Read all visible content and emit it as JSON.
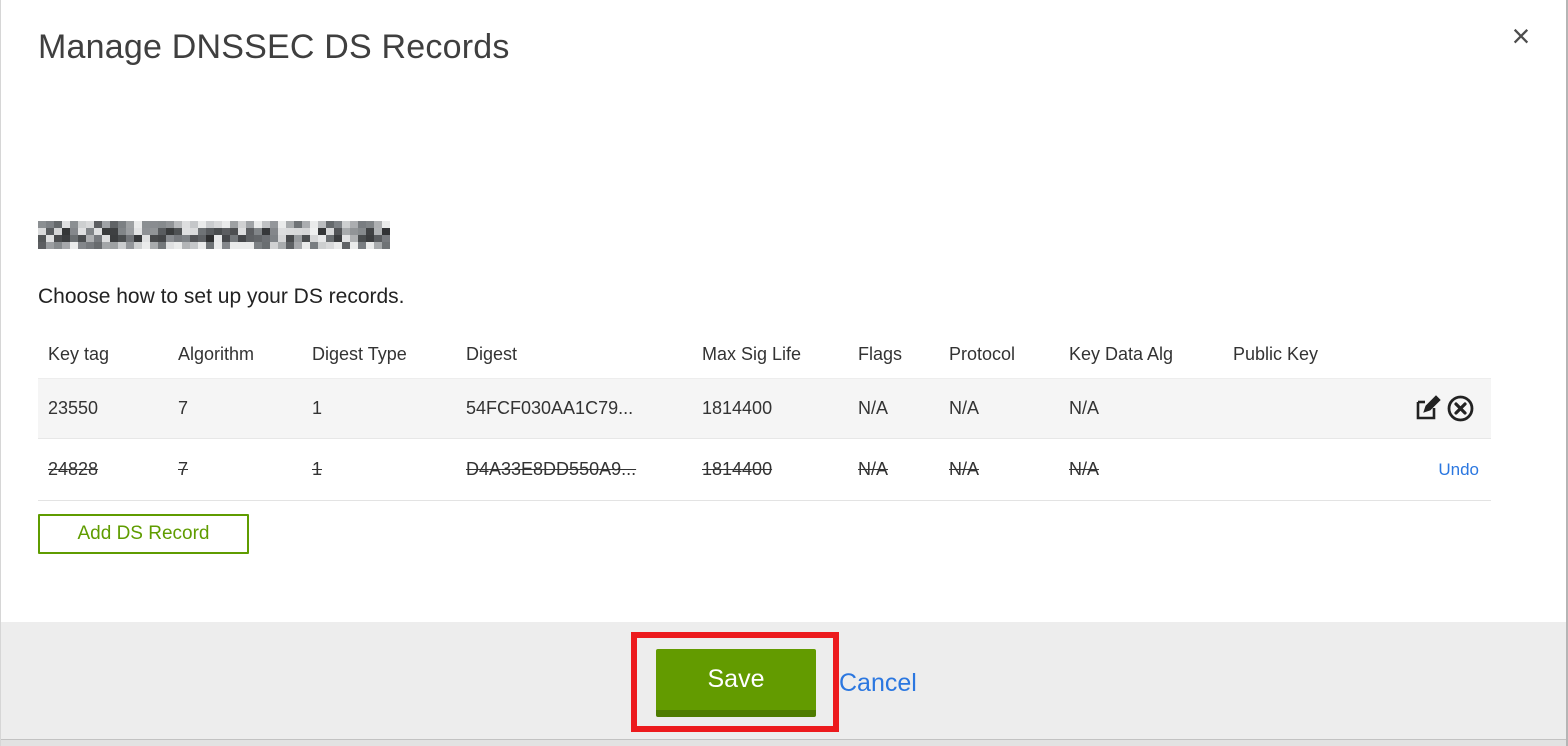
{
  "modal": {
    "title": "Manage DNSSEC DS Records",
    "close_icon": "×",
    "instruction": "Choose how to set up your DS records.",
    "domain_text_redacted": "(redacted domain name)"
  },
  "table": {
    "columns": {
      "key_tag": "Key tag",
      "algorithm": "Algorithm",
      "digest_type": "Digest Type",
      "digest": "Digest",
      "max_sig_life": "Max Sig Life",
      "flags": "Flags",
      "protocol": "Protocol",
      "key_data_alg": "Key Data Alg",
      "public_key": "Public Key"
    },
    "rows": [
      {
        "key_tag": "23550",
        "algorithm": "7",
        "digest_type": "1",
        "digest": "54FCF030AA1C79...",
        "max_sig_life": "1814400",
        "flags": "N/A",
        "protocol": "N/A",
        "key_data_alg": "N/A",
        "public_key": "",
        "state": "active",
        "actions": [
          "edit",
          "delete"
        ]
      },
      {
        "key_tag": "24828",
        "algorithm": "7",
        "digest_type": "1",
        "digest": "D4A33E8DD550A9...",
        "max_sig_life": "1814400",
        "flags": "N/A",
        "protocol": "N/A",
        "key_data_alg": "N/A",
        "public_key": "",
        "state": "marked-for-deletion",
        "undo_label": "Undo"
      }
    ]
  },
  "buttons": {
    "add_ds_record": "Add DS Record",
    "save": "Save",
    "cancel": "Cancel"
  },
  "colors": {
    "accent_green": "#639b00",
    "green_dark": "#4e7c00",
    "link_blue": "#2b77e0",
    "annotation_red": "#ec1a1d",
    "row_highlight": "#f5f5f5",
    "footer_gray": "#ededed",
    "title_gray": "#3f3f3f"
  }
}
